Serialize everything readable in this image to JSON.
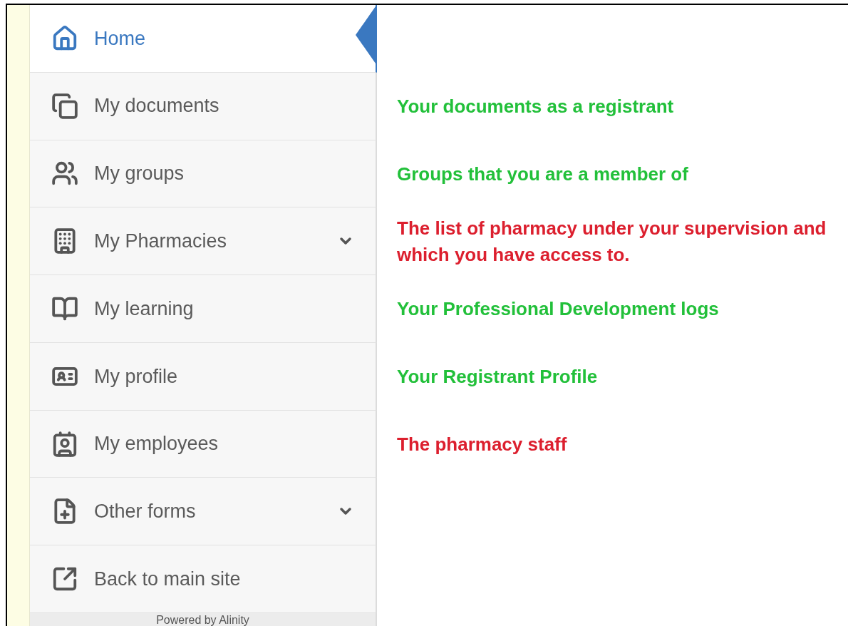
{
  "sidebar": {
    "items": [
      {
        "label": "Home",
        "selected": true,
        "kind": "link"
      },
      {
        "label": "My documents",
        "selected": false,
        "kind": "link",
        "note": {
          "text": "Your documents as a registrant",
          "color": "#22c03a"
        }
      },
      {
        "label": "My groups",
        "selected": false,
        "kind": "link",
        "note": {
          "text": "Groups that you are a member of",
          "color": "#22c03a"
        }
      },
      {
        "label": "My Pharmacies",
        "selected": false,
        "kind": "group",
        "note": {
          "text": "The list of pharmacy under your supervision and which you have access to.",
          "color": "#dc1f2e"
        }
      },
      {
        "label": "My learning",
        "selected": false,
        "kind": "link",
        "note": {
          "text": "Your Professional Development logs",
          "color": "#22c03a"
        }
      },
      {
        "label": "My profile",
        "selected": false,
        "kind": "link",
        "note": {
          "text": "Your Registrant Profile",
          "color": "#22c03a"
        }
      },
      {
        "label": "My employees",
        "selected": false,
        "kind": "link",
        "note": {
          "text": "The pharmacy staff",
          "color": "#dc1f2e"
        }
      },
      {
        "label": "Other forms",
        "selected": false,
        "kind": "group"
      },
      {
        "label": "Back to main site",
        "selected": false,
        "kind": "link"
      }
    ],
    "footer": "Powered by Alinity"
  }
}
